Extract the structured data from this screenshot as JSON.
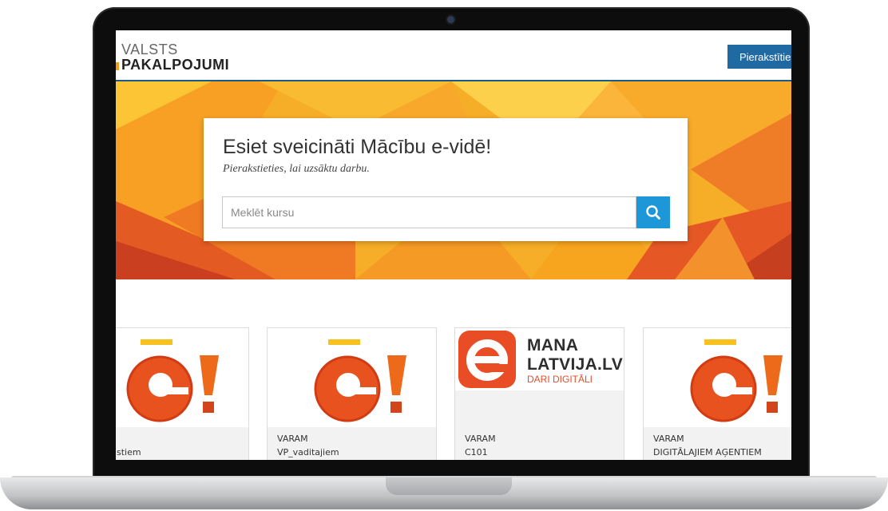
{
  "header": {
    "logo_line1": "VALSTS",
    "logo_line2": "PAKALPOJUMI",
    "login_label": "Pierakstīties"
  },
  "welcome": {
    "title": "Esiet sveicināti Mācību e-vidē!",
    "subtitle": "Pierakstieties, lai uzsāktu darbu.",
    "search_placeholder": "Meklēt kursu"
  },
  "colors": {
    "brand_blue": "#1f6aa3",
    "search_blue": "#1e97d8",
    "hero_orange": "#f7b22a",
    "accent_red": "#e84d25"
  },
  "courses": [
    {
      "org": "",
      "name": "stiem",
      "logo": "e-exclamation-logo"
    },
    {
      "org": "VARAM",
      "name": "VP_vaditajiem",
      "logo": "e-exclamation-logo"
    },
    {
      "org": "VARAM",
      "name": "C101",
      "logo": "mana-latvija-logo",
      "logo_text": [
        "MANA",
        "LATVIJA.LV",
        "DARI DIGITĀLI"
      ]
    },
    {
      "org": "VARAM",
      "name": "DIGITĀLAJIEM AĢENTIEM",
      "logo": "e-exclamation-logo"
    }
  ]
}
